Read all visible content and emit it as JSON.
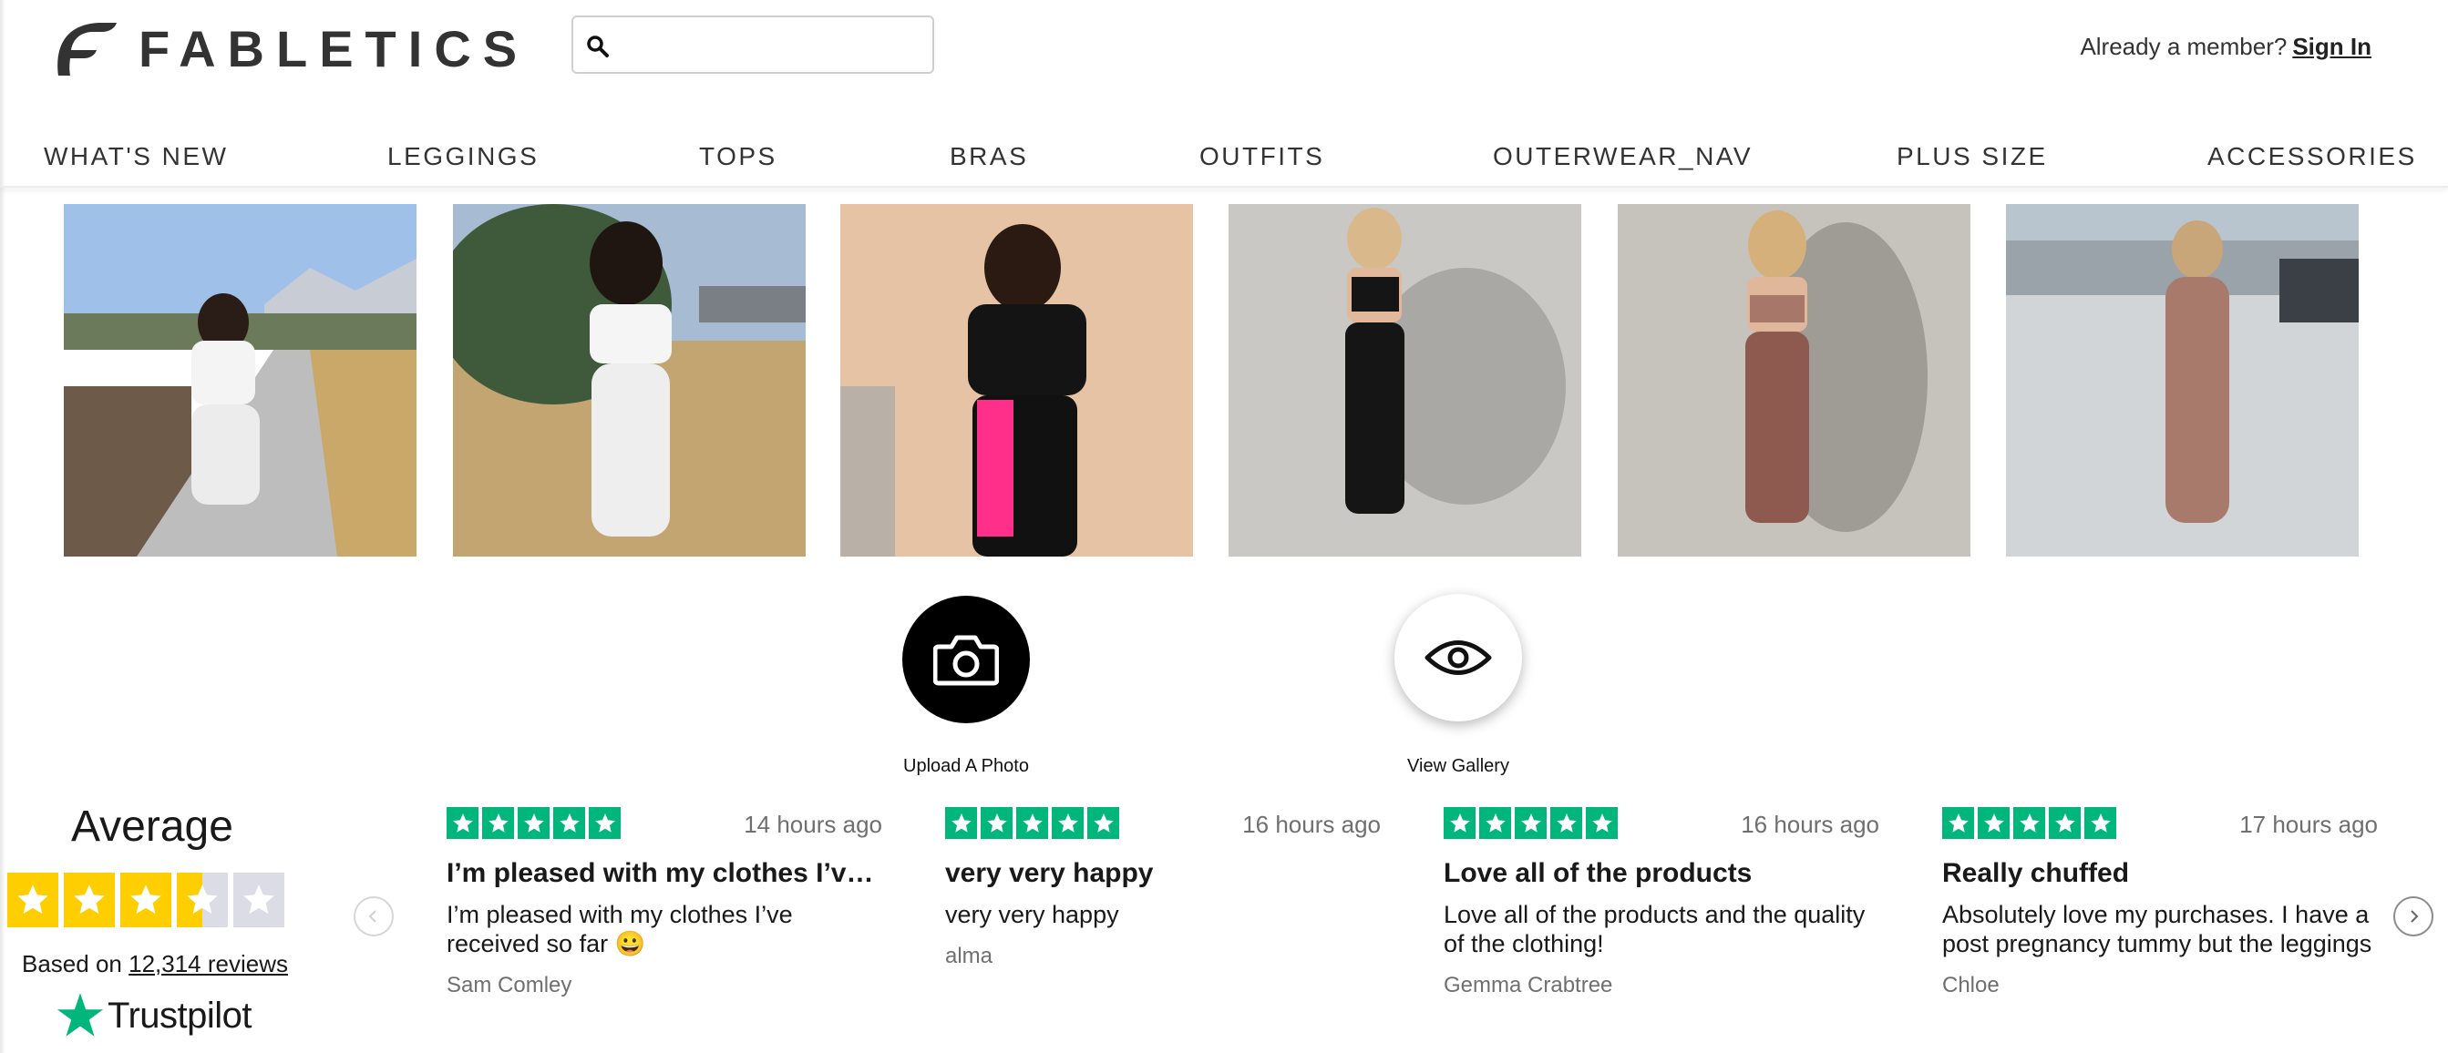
{
  "header": {
    "brand": "FABLETICS",
    "search": {
      "placeholder": "",
      "value": ""
    },
    "member_prompt": "Already a member?",
    "sign_in": "Sign In"
  },
  "nav": {
    "items": [
      {
        "label": "WHAT'S NEW"
      },
      {
        "label": "LEGGINGS"
      },
      {
        "label": "TOPS"
      },
      {
        "label": "BRAS"
      },
      {
        "label": "OUTFITS"
      },
      {
        "label": "OUTERWEAR_NAV"
      },
      {
        "label": "PLUS SIZE"
      },
      {
        "label": "ACCESSORIES"
      }
    ]
  },
  "gallery": {
    "photos": [
      {
        "subject": "woman in white tee and white leggings on sidewalk"
      },
      {
        "subject": "woman in white top and white leggings in yard"
      },
      {
        "subject": "woman in black top and black/pink leggings indoors"
      },
      {
        "subject": "woman in black bra and black leggings against wall"
      },
      {
        "subject": "woman in mauve bra and leggings against wall"
      },
      {
        "subject": "woman in mauve set on rooftop"
      }
    ],
    "upload_label": "Upload A Photo",
    "view_label": "View Gallery"
  },
  "trustpilot": {
    "average_label": "Average",
    "rating_stars": 3.5,
    "based_on": "Based on",
    "reviews_link": "12,314 reviews",
    "brand": "Trustpilot",
    "colors": {
      "green": "#00b67a",
      "summary_star": "#ffce00",
      "empty_star": "#dcdce6"
    }
  },
  "reviews": [
    {
      "stars": 5,
      "time": "14 hours ago",
      "title": "I’m pleased with my clothes I’ve…",
      "body": "I’m pleased with my clothes I’ve received so far 😀",
      "author": "Sam Comley"
    },
    {
      "stars": 5,
      "time": "16 hours ago",
      "title": "very very happy",
      "body": "very very happy",
      "author": "alma"
    },
    {
      "stars": 5,
      "time": "16 hours ago",
      "title": "Love all of the products",
      "body": "Love all of the products and the quality of the clothing!",
      "author": "Gemma Crabtree"
    },
    {
      "stars": 5,
      "time": "17 hours ago",
      "title": "Really chuffed",
      "body": "Absolutely love my purchases. I have a post pregnancy tummy but the leggings",
      "author": "Chloe"
    }
  ]
}
